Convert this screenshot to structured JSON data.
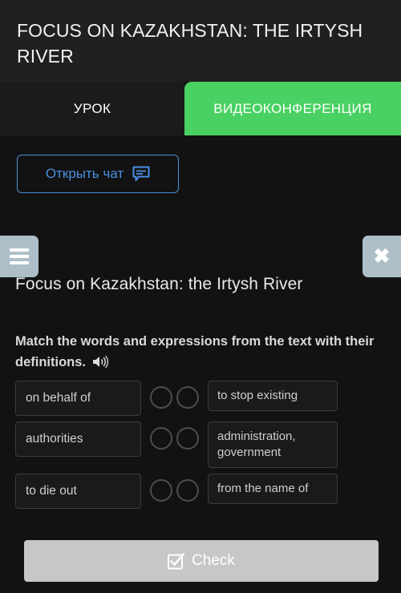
{
  "header": {
    "title": "FOCUS ON KAZAKHSTAN: THE IRTYSH RIVER"
  },
  "tabs": [
    {
      "label": "УРОК",
      "name": "tab-lesson",
      "active": false
    },
    {
      "label": "ВИДЕОКОНФЕРЕНЦИЯ",
      "name": "tab-videoconference",
      "active": true
    }
  ],
  "chat": {
    "open_chat_label": "Открыть чат",
    "icon": "chat-bubble-icon"
  },
  "side_controls": {
    "menu_icon": "hamburger-menu-icon",
    "close_icon": "close-icon"
  },
  "main": {
    "lesson_title": "Focus on Kazakhstan: the Irtysh River",
    "instruction": "Match the words and expressions from the text with their definitions.",
    "audio_icon": "speaker-icon"
  },
  "match_exercise": {
    "rows": [
      {
        "word": "on behalf of",
        "definition": "to stop existing"
      },
      {
        "word": "authorities",
        "definition": "administration, government"
      },
      {
        "word": "to die out",
        "definition": "from the name of"
      }
    ]
  },
  "check": {
    "label": "Check",
    "icon": "checkbox-checked-icon"
  },
  "colors": {
    "accent_green": "#4ad163",
    "link_blue": "#4a90e2",
    "page_bg": "#121212",
    "header_bg": "#202020",
    "side_button_bg": "#aebfc9",
    "check_button_bg": "#c7c7c7"
  }
}
